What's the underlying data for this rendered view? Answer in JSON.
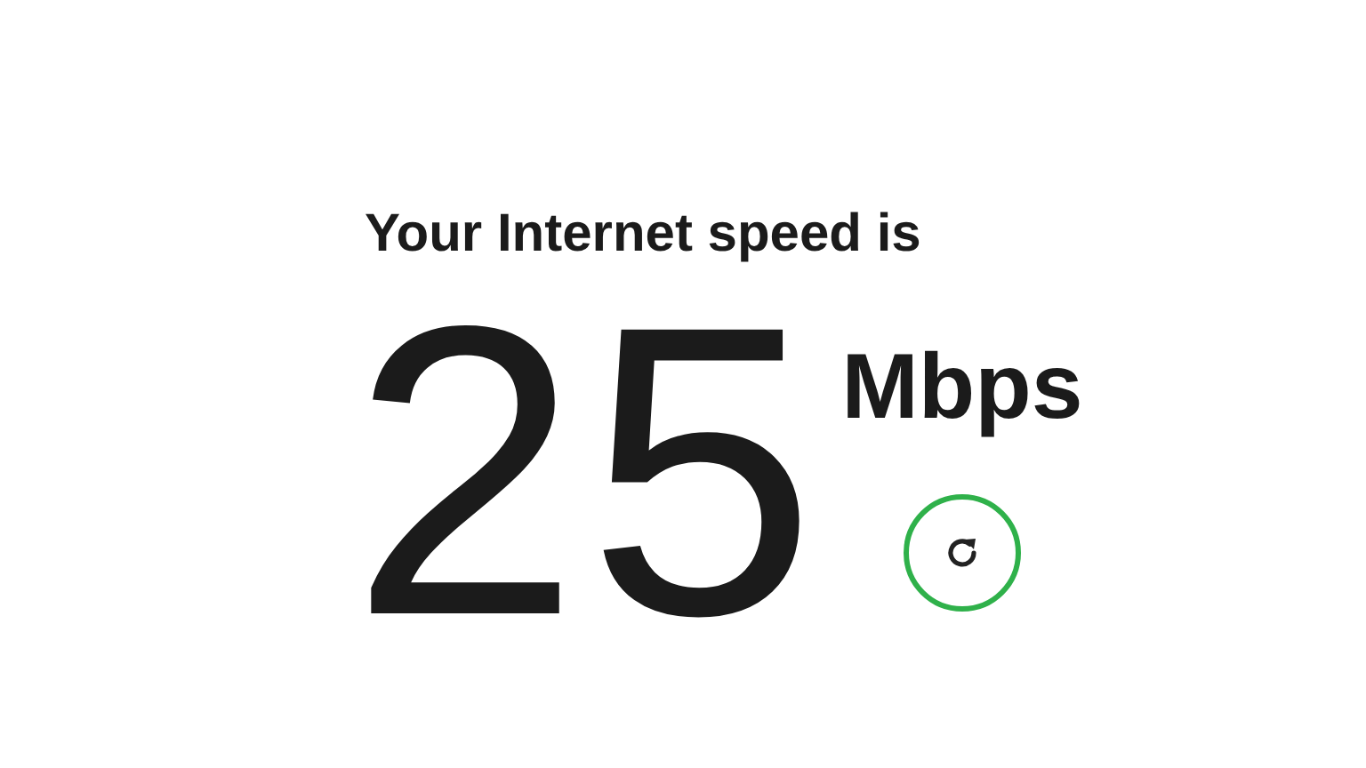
{
  "heading": "Your Internet speed is",
  "speed": "25",
  "unit": "Mbps"
}
